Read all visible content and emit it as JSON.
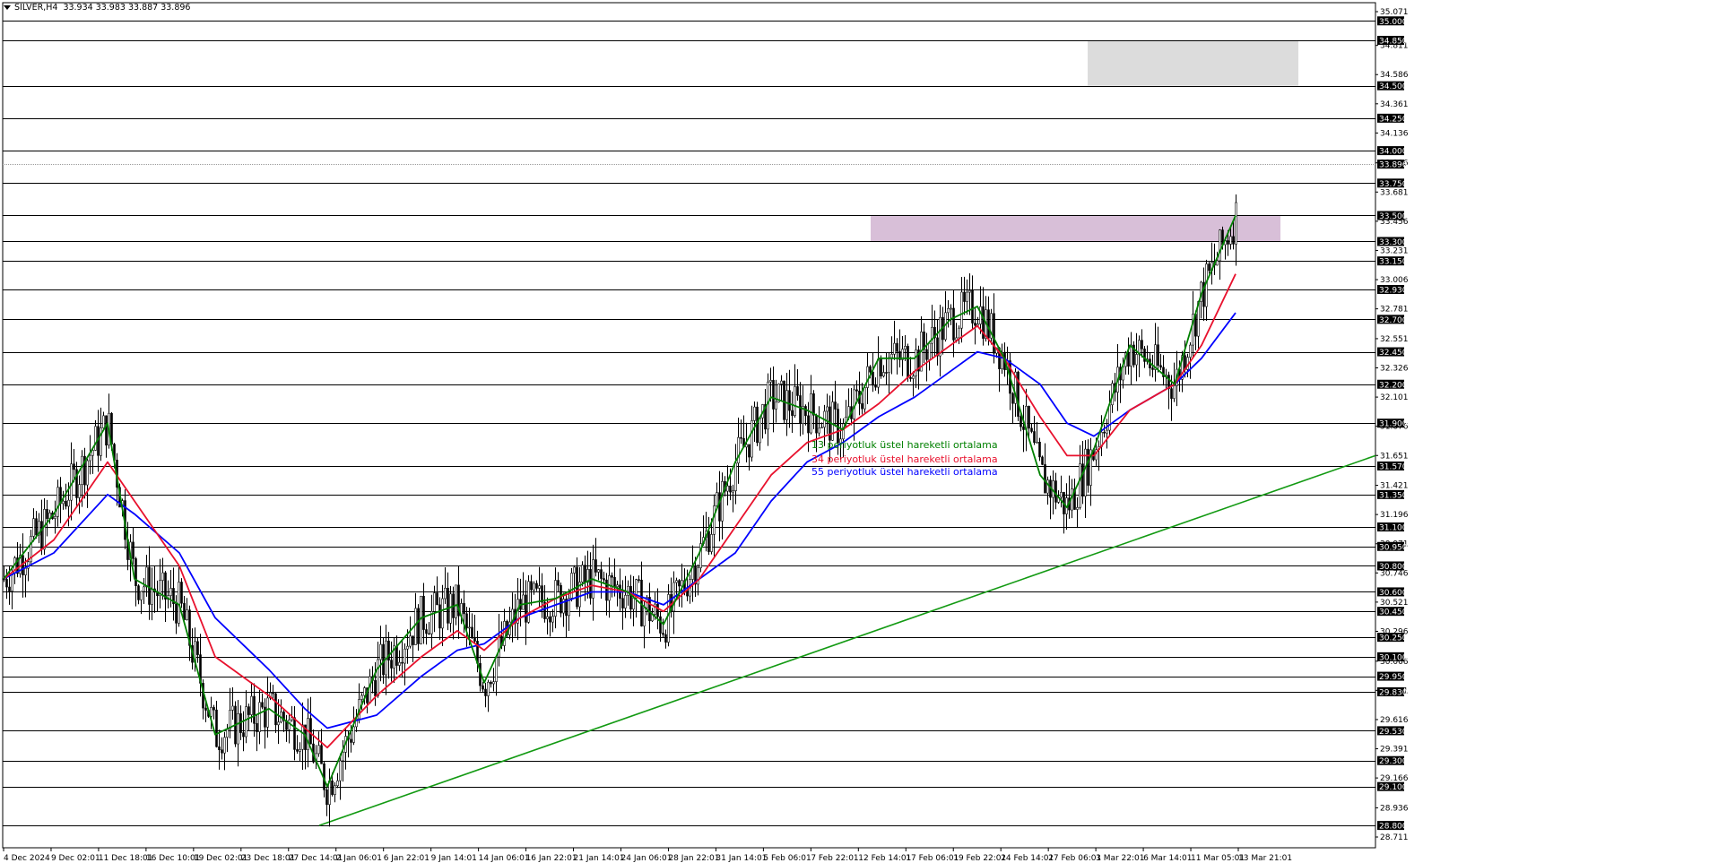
{
  "header": {
    "symbol": "SILVER,H4",
    "ohlc": "33.934 33.983 33.887 33.896",
    "menu_icon": "triangle-down-icon"
  },
  "price_axis": {
    "ticks": [
      "35.071",
      "34.811",
      "34.586",
      "34.361",
      "34.136",
      "33.906",
      "33.681",
      "33.456",
      "33.231",
      "33.006",
      "32.781",
      "32.551",
      "32.326",
      "32.101",
      "31.876",
      "31.651",
      "31.421",
      "31.196",
      "30.971",
      "30.746",
      "30.521",
      "30.296",
      "30.066",
      "29.841",
      "29.616",
      "29.391",
      "29.166",
      "28.936",
      "28.711"
    ],
    "level_labels": [
      "35.000",
      "34.850",
      "34.500",
      "34.250",
      "34.000",
      "33.896",
      "33.750",
      "33.500",
      "33.300",
      "33.150",
      "32.930",
      "32.700",
      "32.450",
      "32.200",
      "31.900",
      "31.570",
      "31.350",
      "31.100",
      "30.950",
      "30.800",
      "30.600",
      "30.450",
      "30.250",
      "30.100",
      "29.950",
      "29.830",
      "29.530",
      "29.300",
      "29.100",
      "28.800"
    ],
    "current_price": "33.896"
  },
  "time_axis": {
    "labels": [
      "4 Dec 2024",
      "9 Dec 02:01",
      "11 Dec 18:01",
      "16 Dec 10:01",
      "19 Dec 02:01",
      "23 Dec 18:01",
      "27 Dec 14:01",
      "2 Jan 06:01",
      "6 Jan 22:01",
      "9 Jan 14:01",
      "14 Jan 06:01",
      "16 Jan 22:01",
      "21 Jan 14:01",
      "24 Jan 06:01",
      "28 Jan 22:01",
      "31 Jan 14:01",
      "5 Feb 06:01",
      "7 Feb 22:01",
      "12 Feb 14:01",
      "17 Feb 06:01",
      "19 Feb 22:01",
      "24 Feb 14:01",
      "27 Feb 06:01",
      "3 Mar 22:01",
      "6 Mar 14:01",
      "11 Mar 05:01",
      "13 Mar 21:01"
    ]
  },
  "legend": {
    "ema13": "13 periyotluk üstel hareketli ortalama",
    "ema34": "34 periyotluk üstel hareketli ortalama",
    "ema55": "55 periyotluk üstel hareketli ortalama"
  },
  "colors": {
    "ema13": "#008000",
    "ema34": "#e8112d",
    "ema55": "#0000ff",
    "trendline": "#139a13",
    "grey_zone": "#dcdcdc",
    "purple_zone": "#d8bfd8",
    "candles": "#000000",
    "level_lines": "#000000",
    "label_bg": "#000000"
  },
  "zones": [
    {
      "name": "grey-supply-zone",
      "from_price": 34.5,
      "to_price": 34.85,
      "from_date": "6 Mar",
      "to_date": "14 Mar"
    },
    {
      "name": "purple-resistance-zone",
      "from_price": 33.3,
      "to_price": 33.5,
      "from_date": "13 Feb",
      "to_date": "14 Mar"
    }
  ],
  "chart_data": {
    "type": "candlestick",
    "symbol": "SILVER",
    "timeframe": "H4",
    "price_range": [
      28.711,
      35.071
    ],
    "horizontal_levels": [
      35.0,
      34.85,
      34.5,
      34.25,
      34.0,
      33.75,
      33.5,
      33.3,
      33.15,
      32.93,
      32.7,
      32.45,
      32.2,
      31.9,
      31.57,
      31.35,
      31.1,
      30.95,
      30.8,
      30.6,
      30.45,
      30.25,
      30.1,
      29.95,
      29.83,
      29.53,
      29.3,
      29.1,
      28.8
    ],
    "ema13": [
      [
        4,
        30.7
      ],
      [
        60,
        31.2
      ],
      [
        120,
        31.9
      ],
      [
        150,
        30.7
      ],
      [
        200,
        30.5
      ],
      [
        240,
        29.5
      ],
      [
        300,
        29.7
      ],
      [
        340,
        29.5
      ],
      [
        365,
        29.1
      ],
      [
        420,
        30.0
      ],
      [
        470,
        30.4
      ],
      [
        510,
        30.5
      ],
      [
        540,
        29.9
      ],
      [
        580,
        30.5
      ],
      [
        620,
        30.55
      ],
      [
        660,
        30.7
      ],
      [
        700,
        30.6
      ],
      [
        740,
        30.35
      ],
      [
        780,
        30.9
      ],
      [
        820,
        31.6
      ],
      [
        860,
        32.1
      ],
      [
        900,
        32.0
      ],
      [
        940,
        31.85
      ],
      [
        980,
        32.4
      ],
      [
        1020,
        32.4
      ],
      [
        1060,
        32.7
      ],
      [
        1090,
        32.8
      ],
      [
        1120,
        32.4
      ],
      [
        1160,
        31.5
      ],
      [
        1190,
        31.25
      ],
      [
        1220,
        31.7
      ],
      [
        1260,
        32.5
      ],
      [
        1310,
        32.2
      ],
      [
        1340,
        32.9
      ],
      [
        1378,
        33.5
      ]
    ],
    "ema34": [
      [
        4,
        30.7
      ],
      [
        60,
        31.0
      ],
      [
        120,
        31.6
      ],
      [
        150,
        31.3
      ],
      [
        200,
        30.8
      ],
      [
        240,
        30.1
      ],
      [
        300,
        29.8
      ],
      [
        340,
        29.55
      ],
      [
        365,
        29.4
      ],
      [
        420,
        29.8
      ],
      [
        470,
        30.1
      ],
      [
        510,
        30.3
      ],
      [
        540,
        30.15
      ],
      [
        580,
        30.4
      ],
      [
        620,
        30.55
      ],
      [
        660,
        30.65
      ],
      [
        700,
        30.6
      ],
      [
        740,
        30.45
      ],
      [
        780,
        30.7
      ],
      [
        820,
        31.1
      ],
      [
        860,
        31.5
      ],
      [
        900,
        31.75
      ],
      [
        940,
        31.85
      ],
      [
        980,
        32.05
      ],
      [
        1020,
        32.3
      ],
      [
        1060,
        32.5
      ],
      [
        1090,
        32.65
      ],
      [
        1120,
        32.4
      ],
      [
        1160,
        31.95
      ],
      [
        1190,
        31.65
      ],
      [
        1220,
        31.65
      ],
      [
        1260,
        32.0
      ],
      [
        1310,
        32.2
      ],
      [
        1340,
        32.5
      ],
      [
        1378,
        33.05
      ]
    ],
    "ema55": [
      [
        4,
        30.7
      ],
      [
        60,
        30.9
      ],
      [
        120,
        31.35
      ],
      [
        150,
        31.2
      ],
      [
        200,
        30.9
      ],
      [
        240,
        30.4
      ],
      [
        300,
        30.0
      ],
      [
        340,
        29.7
      ],
      [
        365,
        29.55
      ],
      [
        420,
        29.65
      ],
      [
        470,
        29.95
      ],
      [
        510,
        30.15
      ],
      [
        540,
        30.2
      ],
      [
        580,
        30.4
      ],
      [
        620,
        30.5
      ],
      [
        660,
        30.6
      ],
      [
        700,
        30.6
      ],
      [
        740,
        30.5
      ],
      [
        780,
        30.7
      ],
      [
        820,
        30.9
      ],
      [
        860,
        31.3
      ],
      [
        900,
        31.6
      ],
      [
        940,
        31.75
      ],
      [
        980,
        31.95
      ],
      [
        1020,
        32.1
      ],
      [
        1060,
        32.3
      ],
      [
        1090,
        32.45
      ],
      [
        1120,
        32.4
      ],
      [
        1160,
        32.2
      ],
      [
        1190,
        31.9
      ],
      [
        1220,
        31.8
      ],
      [
        1260,
        32.0
      ],
      [
        1310,
        32.2
      ],
      [
        1340,
        32.4
      ],
      [
        1378,
        32.75
      ]
    ],
    "trendline": {
      "from": {
        "date": "2 Jan",
        "price": 28.8
      },
      "to": {
        "date": "14 Mar+",
        "price": 31.65
      }
    },
    "candles_note": "ohlc series approximated in script"
  }
}
